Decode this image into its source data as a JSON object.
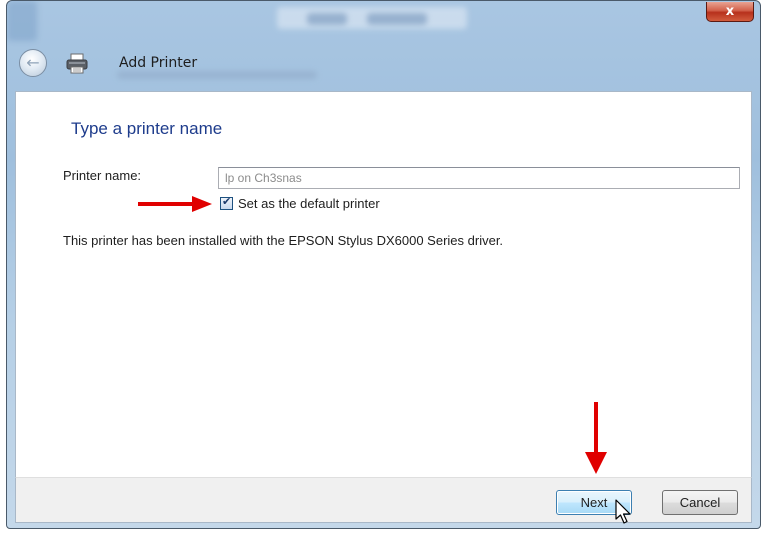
{
  "window": {
    "title": "Add Printer",
    "close_glyph": "x"
  },
  "content": {
    "heading": "Type a printer name",
    "printer_name_label": "Printer name:",
    "printer_name_value": "lp on Ch3snas",
    "default_checkbox_label": "Set as the default printer",
    "default_checkbox_checked": true,
    "info_text": "This printer has been installed with the EPSON Stylus DX6000 Series driver."
  },
  "footer": {
    "next_label": "Next",
    "cancel_label": "Cancel"
  },
  "icons": {
    "back": "back-arrow-icon",
    "printer": "printer-icon",
    "cursor": "mouse-pointer-icon",
    "annotation_arrows": "red-arrow-icon"
  },
  "colors": {
    "heading": "#1e3c8c",
    "annotation_arrow": "#e00000",
    "close_button": "#c8412b"
  }
}
